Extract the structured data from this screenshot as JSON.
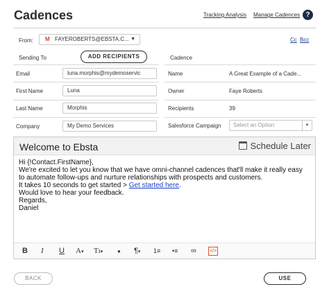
{
  "header": {
    "title": "Cadences",
    "tracking_link": "Tracking Analysis",
    "manage_link": "Manage Cadences",
    "help_icon": "?"
  },
  "from": {
    "label": "From:",
    "provider_icon": "M",
    "value": "FAYEROBERTS@EBSTA.C...",
    "cc": "Cc",
    "bcc": "Bcc"
  },
  "sending_to": {
    "label": "Sending To",
    "add_button": "ADD RECIPIENTS",
    "fields": [
      {
        "label": "Email",
        "value": "luna.morphis@mydemoservic"
      },
      {
        "label": "First Name",
        "value": "Luna"
      },
      {
        "label": "Last Name",
        "value": "Morphis"
      },
      {
        "label": "Company",
        "value": "My Demo Services"
      }
    ]
  },
  "cadence": {
    "label": "Cadence",
    "fields": [
      {
        "label": "Name",
        "value": "A Great Example of a Cade..."
      },
      {
        "label": "Owner",
        "value": "Faye Roberts"
      },
      {
        "label": "Recipients",
        "value": "39"
      },
      {
        "label": "Salesforce Campaign",
        "placeholder": "Select an Option"
      }
    ]
  },
  "editor": {
    "subject": "Welcome to Ebsta",
    "schedule_button": "Schedule Later",
    "body": {
      "line1": "Hi {!Contact.FirstName},",
      "line2": "We're excited to let you know that we have omni-channel cadences that'll make it really easy",
      "line3": "to automate follow-ups and nurture relationships with prospects and customers.",
      "line4_prefix": "It takes 10 seconds to get started > ",
      "line4_link": "Get started here",
      "line4_suffix": ".",
      "line5": "Would love to hear your feedback.",
      "line6": "Regards,",
      "line7": "Daniel"
    },
    "toolbar": {
      "bold": "B",
      "italic": "I",
      "underline": "U",
      "font_color": "A",
      "font_size": "Tı",
      "dropdown": "▾",
      "ink": "●",
      "paragraph": "¶",
      "ordered_list": "1≡",
      "bullet_list": "•≡",
      "link": "∞",
      "code": "</>"
    }
  },
  "footer": {
    "back": "BACK",
    "use": "USE"
  }
}
